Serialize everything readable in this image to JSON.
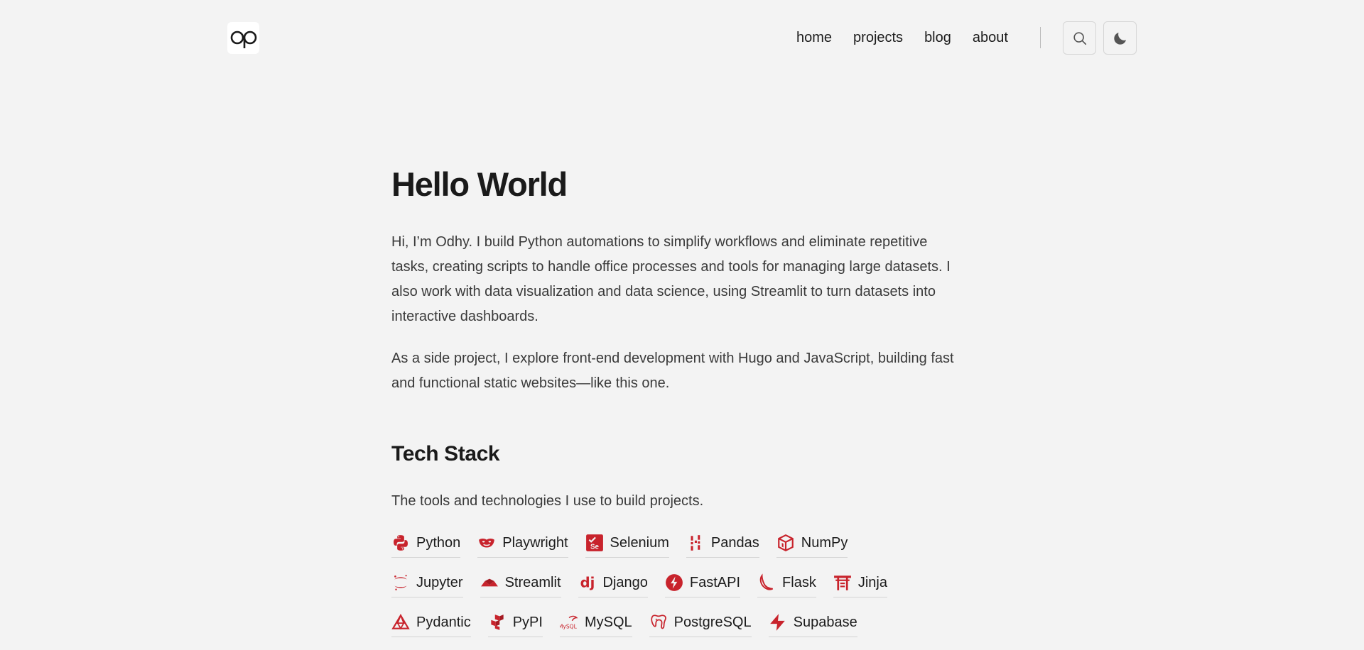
{
  "site": {
    "logo_text": "op"
  },
  "nav": {
    "items": [
      {
        "label": "home"
      },
      {
        "label": "projects"
      },
      {
        "label": "blog"
      },
      {
        "label": "about"
      }
    ]
  },
  "icons": {
    "search": "search-icon",
    "theme": "moon-icon"
  },
  "hero": {
    "title": "Hello World",
    "paragraph1": "Hi, I’m Odhy. I build Python automations to simplify workflows and eliminate repetitive tasks, creating scripts to handle office processes and tools for managing large datasets. I also work with data visualization and data science, using Streamlit to turn datasets into interactive dashboards.",
    "paragraph2": "As a side project, I explore front-end development with Hugo and JavaScript, building fast and functional static websites—like this one."
  },
  "tech_stack": {
    "title": "Tech Stack",
    "description": "The tools and technologies I use to build projects.",
    "accent_color": "#c8232c",
    "rows": [
      [
        {
          "label": "Python",
          "icon": "python-icon"
        },
        {
          "label": "Playwright",
          "icon": "playwright-icon"
        },
        {
          "label": "Selenium",
          "icon": "selenium-icon"
        },
        {
          "label": "Pandas",
          "icon": "pandas-icon"
        },
        {
          "label": "NumPy",
          "icon": "numpy-icon"
        }
      ],
      [
        {
          "label": "Jupyter",
          "icon": "jupyter-icon"
        },
        {
          "label": "Streamlit",
          "icon": "streamlit-icon"
        },
        {
          "label": "Django",
          "icon": "django-icon"
        },
        {
          "label": "FastAPI",
          "icon": "fastapi-icon"
        },
        {
          "label": "Flask",
          "icon": "flask-icon"
        },
        {
          "label": "Jinja",
          "icon": "jinja-icon"
        }
      ],
      [
        {
          "label": "Pydantic",
          "icon": "pydantic-icon"
        },
        {
          "label": "PyPI",
          "icon": "pypi-icon"
        },
        {
          "label": "MySQL",
          "icon": "mysql-icon"
        },
        {
          "label": "PostgreSQL",
          "icon": "postgresql-icon"
        },
        {
          "label": "Supabase",
          "icon": "supabase-icon"
        }
      ]
    ]
  }
}
